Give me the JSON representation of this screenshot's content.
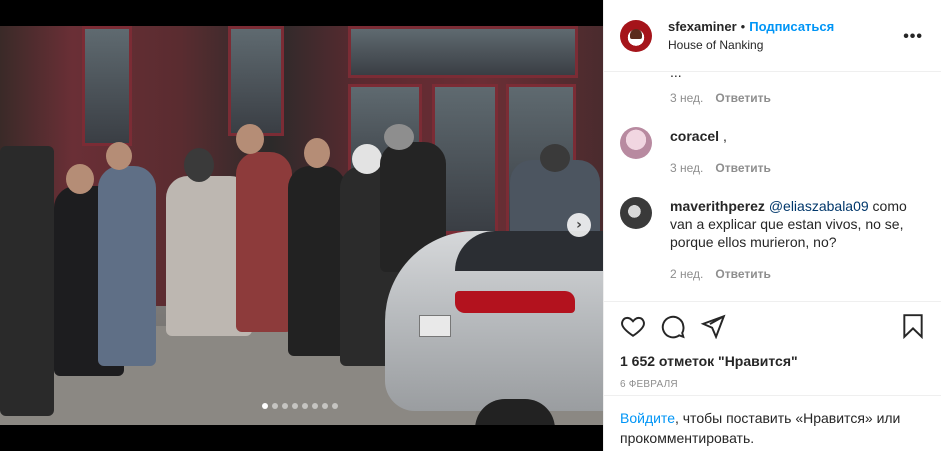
{
  "post": {
    "username": "sfexaminer",
    "separator": "•",
    "follow_label": "Подписаться",
    "location": "House of Nanking",
    "more_label": "•••"
  },
  "comments": [
    {
      "partial_text": "...",
      "time": "3 нед.",
      "reply_label": "Ответить"
    },
    {
      "user": "coracel",
      "text": ",",
      "time": "3 нед.",
      "reply_label": "Ответить"
    },
    {
      "user": "maverithperez",
      "mention": "@eliaszabala09",
      "text": " como van a explicar que estan vivos, no se, porque ellos murieron, no?",
      "time": "2 нед.",
      "reply_label": "Ответить"
    }
  ],
  "actions": {
    "icons": [
      "heart-icon",
      "comment-icon",
      "share-icon",
      "bookmark-icon"
    ],
    "likes": "1 652 отметок \"Нравится\"",
    "date": "6 февраля"
  },
  "login_prompt": {
    "link": "Войдите",
    "text": ", чтобы поставить «Нравится» или прокомментировать."
  },
  "carousel": {
    "total": 8,
    "active_index": 0,
    "next_icon": "chevron-right-icon"
  },
  "colors": {
    "link_blue": "#0095f6",
    "mention": "#00376b",
    "secondary_text": "#8e8e8e"
  }
}
